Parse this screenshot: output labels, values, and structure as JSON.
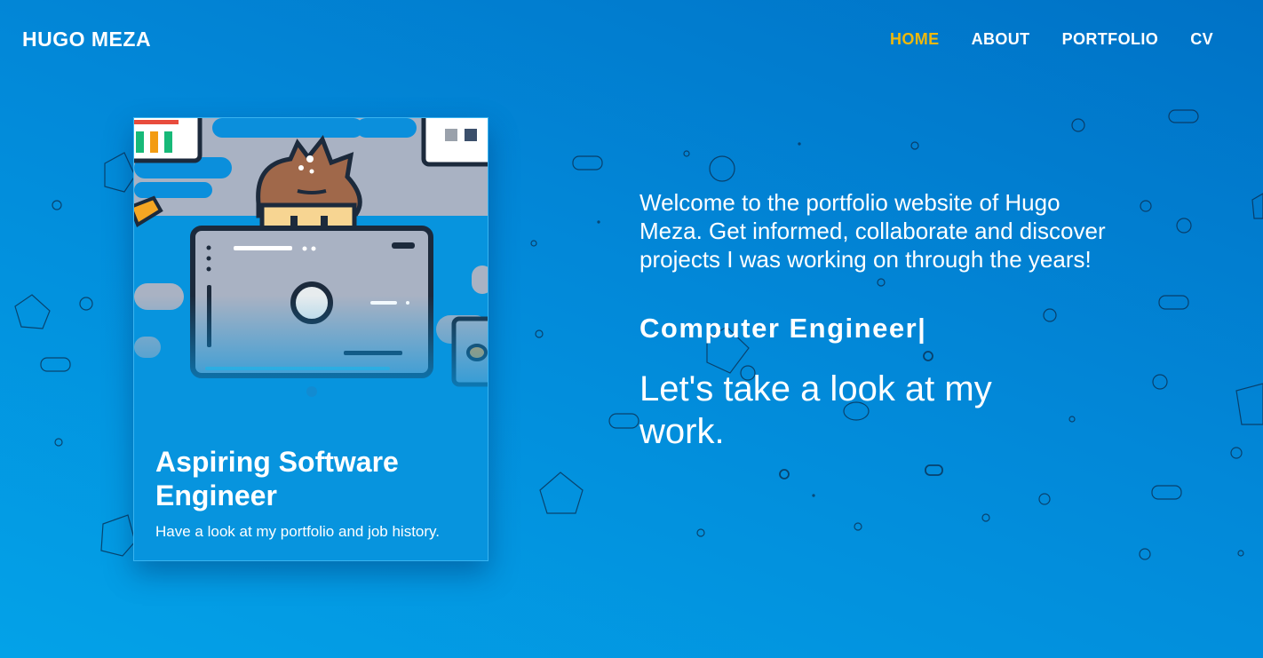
{
  "brand": {
    "name": "HUGO MEZA"
  },
  "nav": {
    "items": [
      {
        "label": "HOME",
        "active": true
      },
      {
        "label": "ABOUT",
        "active": false
      },
      {
        "label": "PORTFOLIO",
        "active": false
      },
      {
        "label": "CV",
        "active": false
      }
    ],
    "active_color": "#f0b90b"
  },
  "card": {
    "title": "Aspiring Software Engineer",
    "text": "Have a look at my portfolio and job history.",
    "image": "developer-at-computer-illustration"
  },
  "intro": {
    "welcome": "Welcome to the portfolio website of Hugo Meza. Get informed, collaborate and discover projects I was working on through the years!",
    "role": "Computer Engineer|",
    "tagline": "Let's take a look at my work."
  },
  "colors": {
    "background_top": "#0072c6",
    "background_bottom": "#03a2e8",
    "accent": "#f0b90b"
  }
}
